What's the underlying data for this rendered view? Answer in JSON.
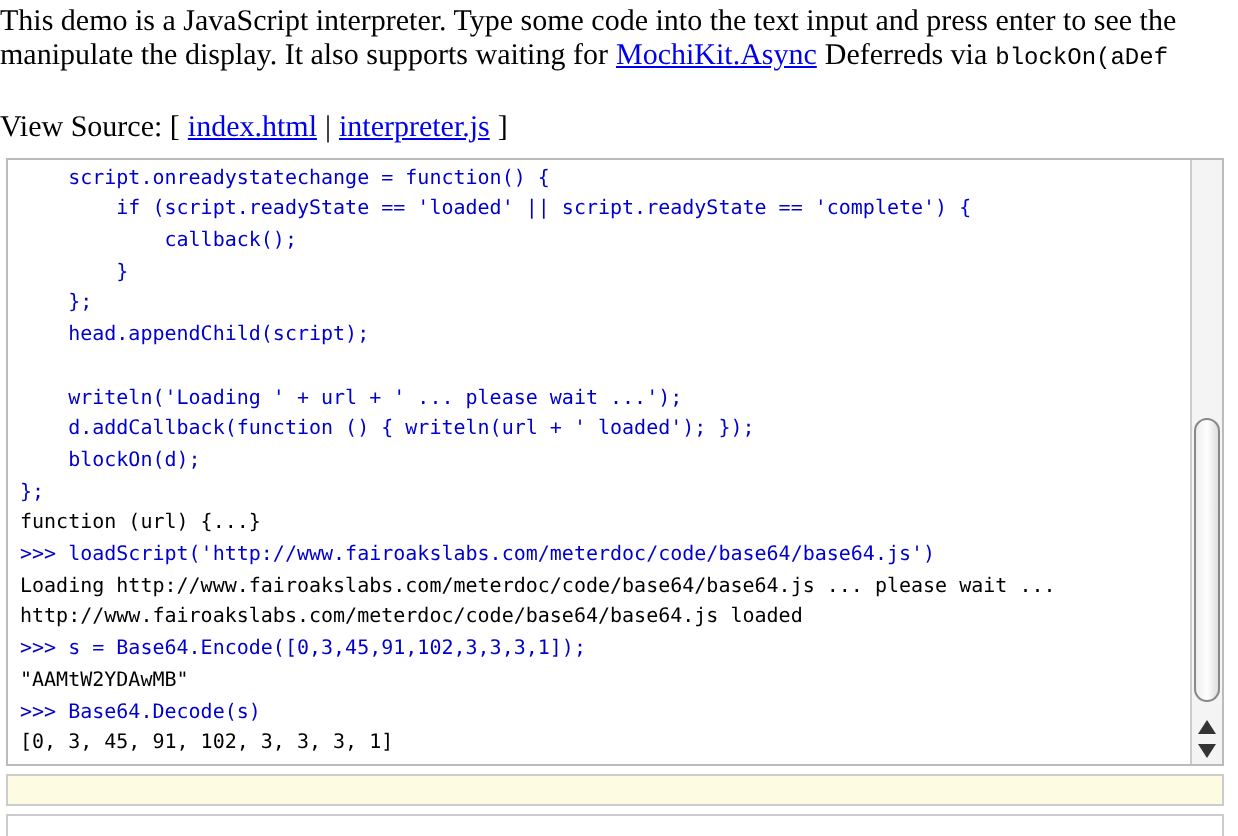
{
  "intro": {
    "line_1": "This demo is a JavaScript interpreter. Type some code into the text input and press enter to see the",
    "line_2_before": "manipulate the display. It also supports waiting for",
    "link": "MochiKit.Async",
    "line_2_after": "Deferreds via",
    "code": "blockOn(aDef"
  },
  "view_source": {
    "label": "View Source: [",
    "links": [
      "index.html",
      "interpreter.js"
    ],
    "separator": "|",
    "end": "]"
  },
  "console": {
    "lines": [
      {
        "kind": "code",
        "text": "    script.onreadystatechange = function() {"
      },
      {
        "kind": "code",
        "text": "        if (script.readyState == 'loaded' || script.readyState == 'complete') {"
      },
      {
        "kind": "code",
        "text": "            callback();"
      },
      {
        "kind": "code",
        "text": "        }"
      },
      {
        "kind": "code",
        "text": "    };"
      },
      {
        "kind": "code",
        "text": "    head.appendChild(script);"
      },
      {
        "kind": "blank"
      },
      {
        "kind": "code",
        "text": "    writeln('Loading ' + url + ' ... please wait ...');"
      },
      {
        "kind": "code",
        "text": "    d.addCallback(function () { writeln(url + ' loaded'); });"
      },
      {
        "kind": "code",
        "text": "    blockOn(d);"
      },
      {
        "kind": "code",
        "text": "};"
      },
      {
        "kind": "output",
        "text": "function (url) {...}"
      },
      {
        "kind": "input",
        "text": ">>> loadScript('http://www.fairoakslabs.com/meterdoc/code/base64/base64.js')"
      },
      {
        "kind": "output",
        "text": "Loading http://www.fairoakslabs.com/meterdoc/code/base64/base64.js ... please wait ..."
      },
      {
        "kind": "output",
        "text": "http://www.fairoakslabs.com/meterdoc/code/base64/base64.js loaded"
      },
      {
        "kind": "input",
        "text": ">>> s = Base64.Encode([0,3,45,91,102,3,3,3,1]);"
      },
      {
        "kind": "output",
        "text": "\"AAMtW2YDAwMB\""
      },
      {
        "kind": "input",
        "text": ">>> Base64.Decode(s)"
      },
      {
        "kind": "output",
        "text": "[0, 3, 45, 91, 102, 3, 3, 3, 1]"
      }
    ]
  }
}
